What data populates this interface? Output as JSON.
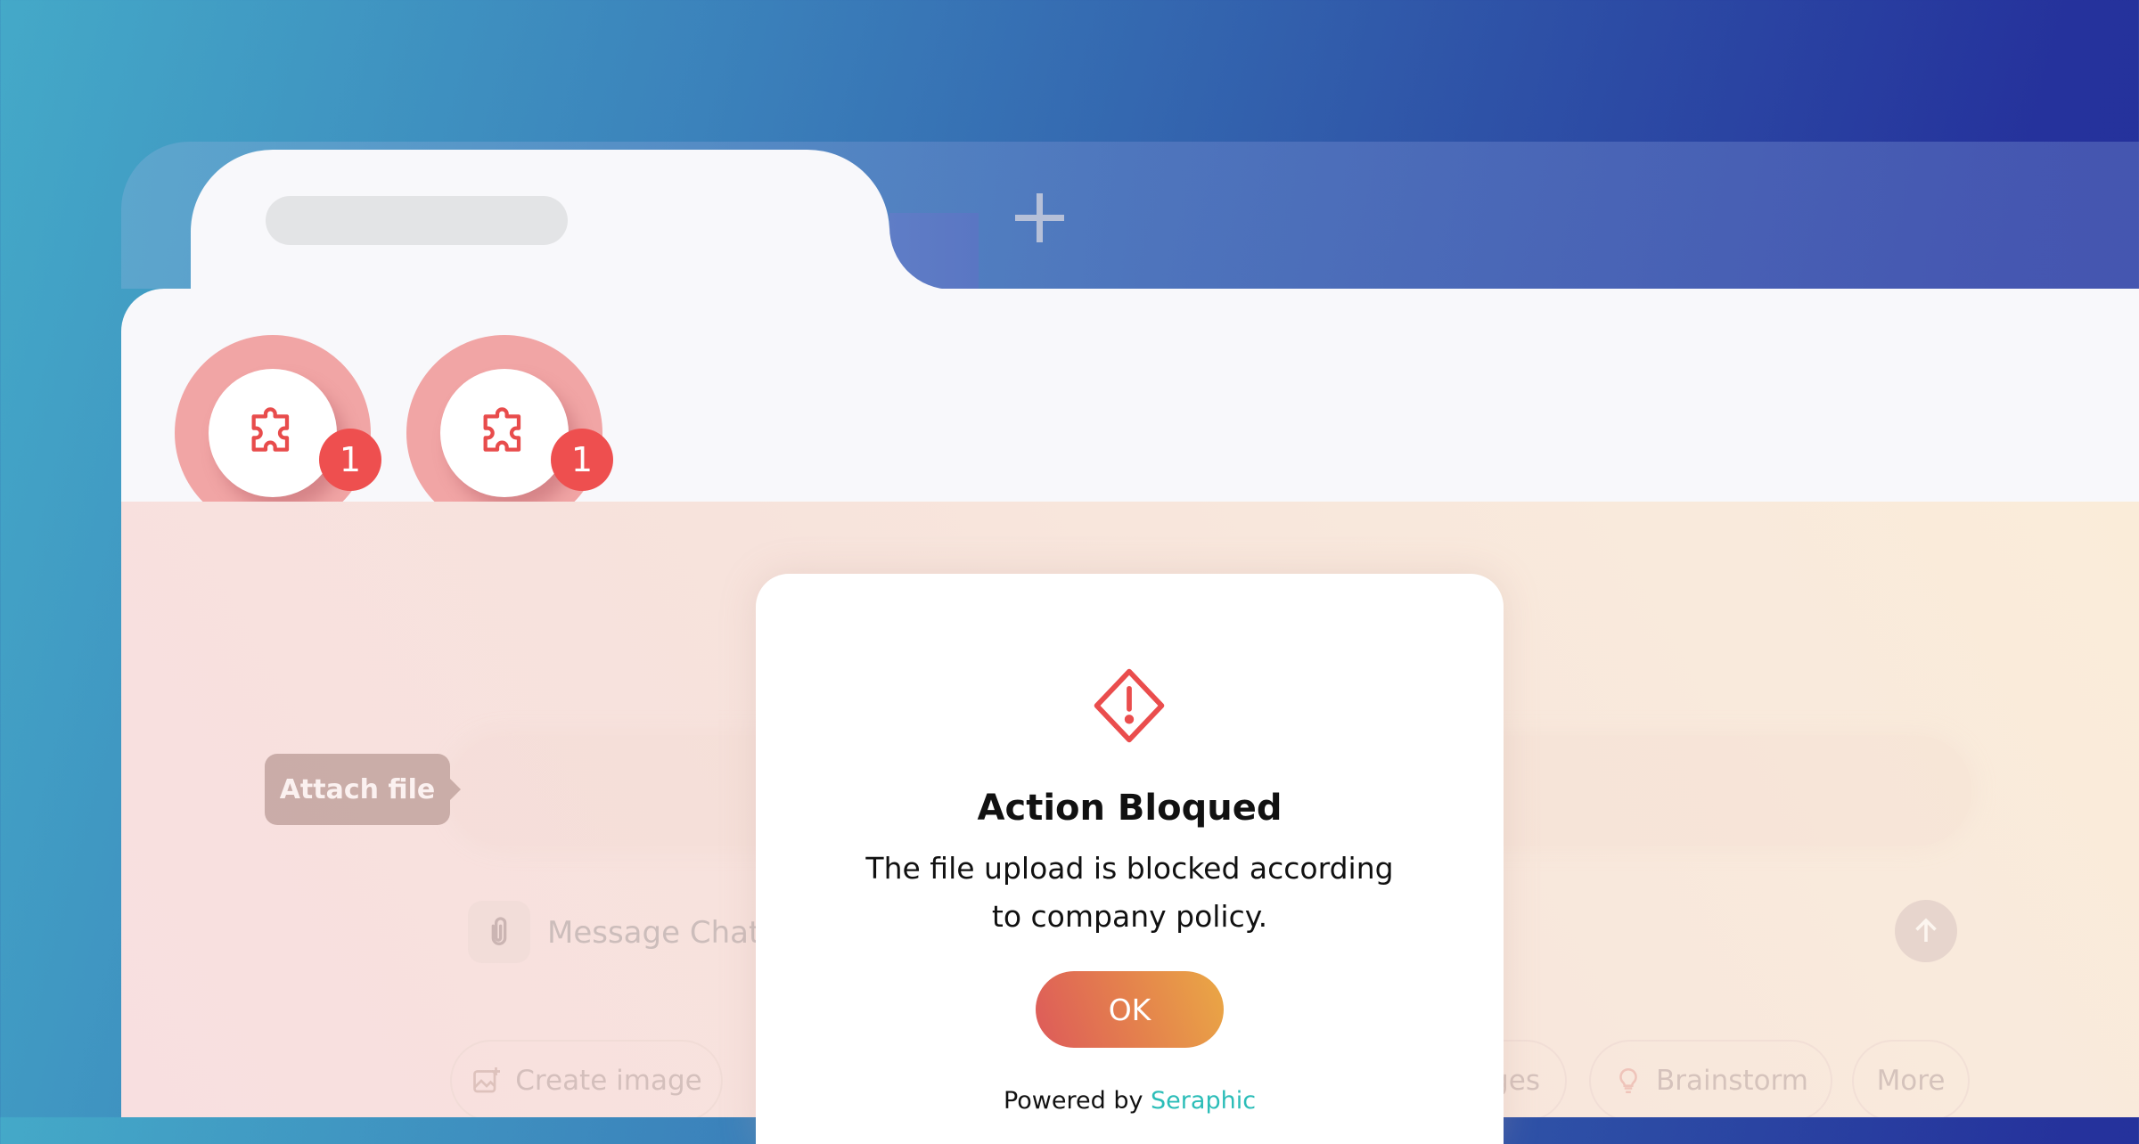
{
  "browser": {
    "new_tab_icon": "plus-icon",
    "tab_title": ""
  },
  "extensions": [
    {
      "icon": "puzzle-icon",
      "badge": "1"
    },
    {
      "icon": "puzzle-icon",
      "badge": "1"
    }
  ],
  "search": {
    "icon": "search-icon",
    "value": ""
  },
  "chat": {
    "tooltip": "Attach file",
    "attach_icon": "paperclip-icon",
    "placeholder": "Message Chat",
    "send_icon": "arrow-up-icon",
    "chips": [
      {
        "label": "Create image",
        "icon": "image-icon"
      },
      {
        "label": "ges",
        "icon": ""
      },
      {
        "label": "Brainstorm",
        "icon": "lightbulb-icon"
      },
      {
        "label": "More",
        "icon": ""
      }
    ]
  },
  "dialog": {
    "icon": "warning-diamond-icon",
    "title": "Action Bloqued",
    "line1": "The file upload is blocked according",
    "line2": "to company policy.",
    "ok_label": "OK",
    "powered_by": "Powered by",
    "brand": "Seraphic"
  },
  "colors": {
    "accent_red": "#ee4f4f",
    "brand_teal": "#2bbdb8",
    "ok_gradient_start": "#dd5a5a",
    "ok_gradient_end": "#eaa845"
  }
}
